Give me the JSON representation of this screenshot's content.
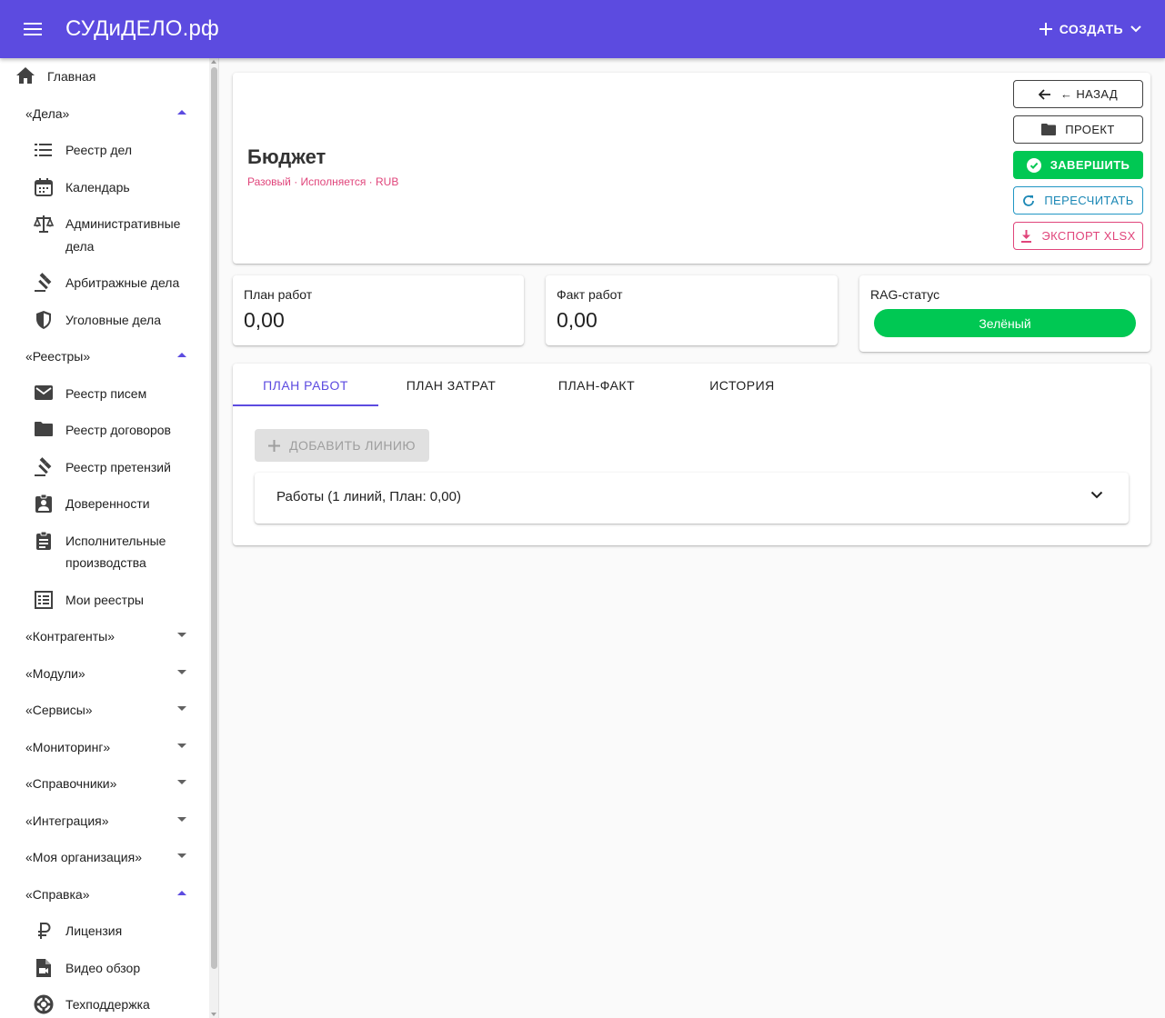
{
  "appbar": {
    "brand": "СУДиДЕЛО.рф",
    "create_label": "СОЗДАТЬ",
    "color": "#5c4be0"
  },
  "sidebar": {
    "home": "Главная",
    "sections": {
      "cases": "«Дела»",
      "registries": "«Реестры»",
      "contractors": "«Контрагенты»",
      "modules": "«Модули»",
      "services": "«Сервисы»",
      "monitoring": "«Мониторинг»",
      "directories": "«Справочники»",
      "integration": "«Интеграция»",
      "my_org": "«Моя организация»",
      "help": "«Справка»"
    },
    "items": {
      "case_registry": "Реестр дел",
      "calendar": "Календарь",
      "admin_cases_1": "Административные",
      "admin_cases_2": "дела",
      "arbitration": "Арбитражные дела",
      "criminal": "Уголовные дела",
      "letters": "Реестр писем",
      "contracts": "Реестр договоров",
      "claims": "Реестр претензий",
      "powers": "Доверенности",
      "enforcement_1": "Исполнительные",
      "enforcement_2": "производства",
      "my_registries": "Мои реестры",
      "license": "Лицензия",
      "video": "Видео обзор",
      "support": "Техподдержка"
    }
  },
  "header": {
    "title": "Бюджет",
    "subtitle": "Разовый · Исполняется · RUB",
    "actions": {
      "back": "← НАЗАД",
      "project": "ПРОЕКТ",
      "finish": "ЗАВЕРШИТЬ",
      "recalc": "ПЕРЕСЧИТАТЬ",
      "export": "ЭКСПОРТ XLSX"
    }
  },
  "stats": {
    "plan_label": "План работ",
    "plan_value": "0,00",
    "fact_label": "Факт работ",
    "fact_value": "0,00",
    "rag_label": "RAG-статус",
    "rag_value": "Зелёный",
    "rag_color": "#00c853"
  },
  "tabs": {
    "items": [
      "ПЛАН РАБОТ",
      "ПЛАН ЗАТРАТ",
      "ПЛАН-ФАКТ",
      "ИСТОРИЯ"
    ],
    "active": 0
  },
  "content": {
    "add_line_label": "ДОБАВИТЬ ЛИНИЮ",
    "accordion_title": "Работы (1 линий, План: 0,00)"
  }
}
